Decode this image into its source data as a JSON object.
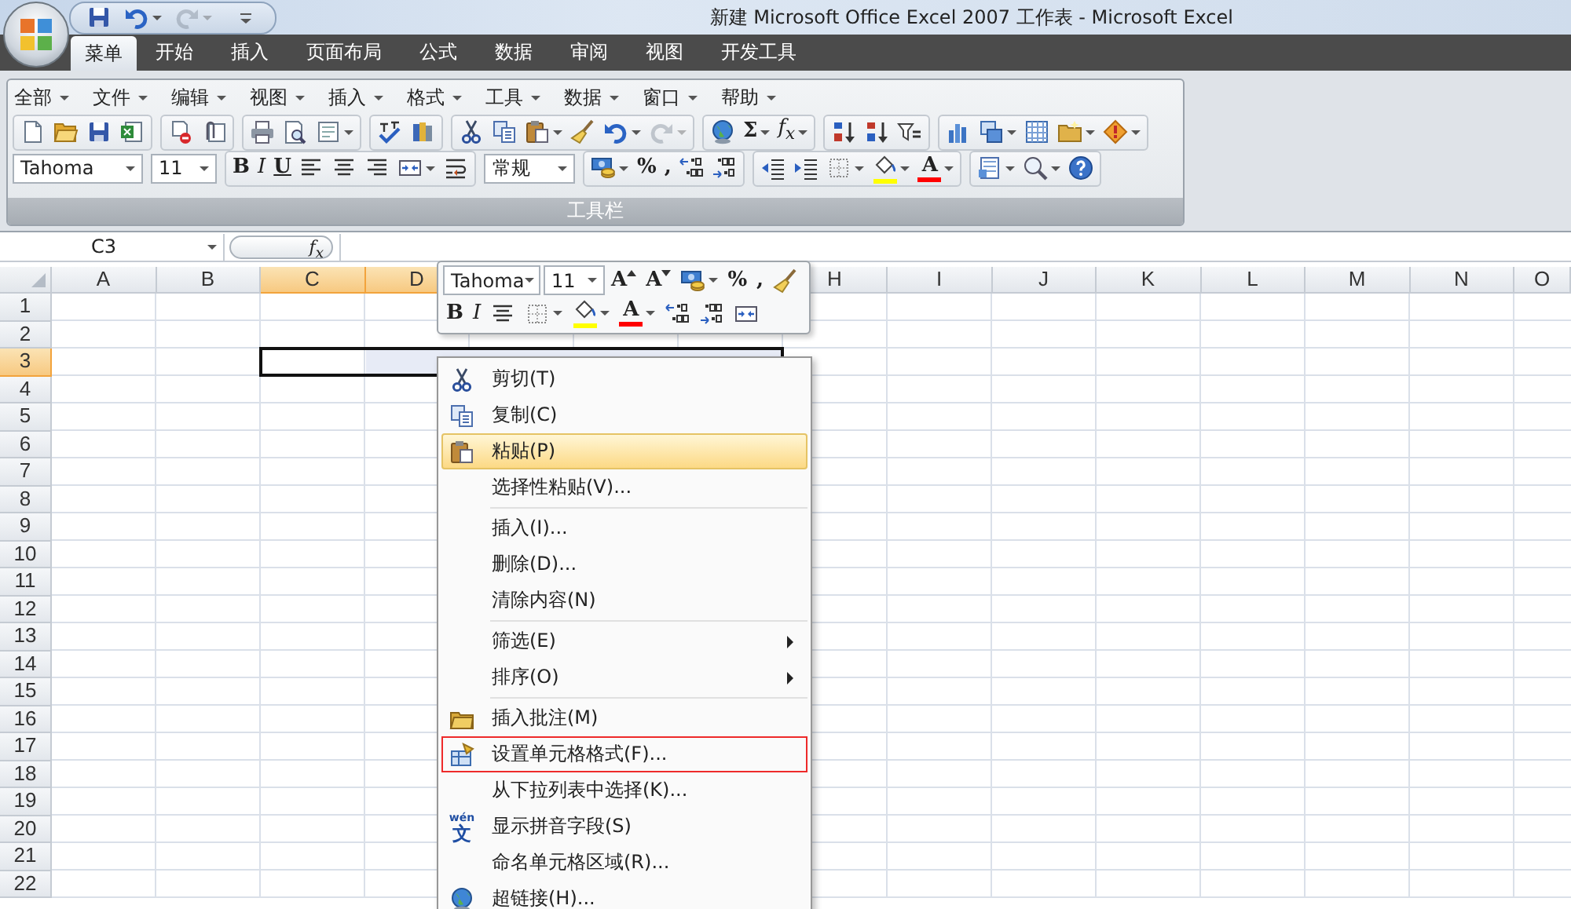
{
  "title_bar": {
    "title": "新建 Microsoft Office Excel 2007 工作表 - Microsoft Excel"
  },
  "quick_access": [
    {
      "kind": "icon"
    },
    {
      "kind": "icon",
      "dropdown": true
    },
    {
      "kind": "icon",
      "dropdown": true,
      "disabled": true
    },
    {
      "kind": "icon"
    }
  ],
  "ribbon_tabs": [
    {
      "label": "菜单",
      "selected": true
    },
    {
      "label": "开始",
      "selected": false
    },
    {
      "label": "插入",
      "selected": false
    },
    {
      "label": "页面布局",
      "selected": false
    },
    {
      "label": "公式",
      "selected": false
    },
    {
      "label": "数据",
      "selected": false
    },
    {
      "label": "审阅",
      "selected": false
    },
    {
      "label": "视图",
      "selected": false
    },
    {
      "label": "开发工具",
      "selected": false
    }
  ],
  "toolbar": {
    "menus": [
      {
        "label": "全部"
      },
      {
        "label": "文件"
      },
      {
        "label": "编辑"
      },
      {
        "label": "视图"
      },
      {
        "label": "插入"
      },
      {
        "label": "格式"
      },
      {
        "label": "工具"
      },
      {
        "label": "数据"
      },
      {
        "label": "窗口"
      },
      {
        "label": "帮助"
      }
    ],
    "standard_groups": [
      [
        {
          "kind": "icon"
        },
        {
          "kind": "icon"
        },
        {
          "kind": "icon"
        },
        {
          "kind": "icon"
        }
      ],
      [
        {
          "kind": "icon"
        },
        {
          "kind": "icon"
        }
      ],
      [
        {
          "kind": "icon"
        },
        {
          "kind": "icon"
        },
        {
          "kind": "icon",
          "dropdown": true
        }
      ],
      [
        {
          "kind": "icon"
        },
        {
          "kind": "icon"
        }
      ],
      [
        {
          "kind": "icon"
        },
        {
          "kind": "icon"
        },
        {
          "kind": "icon",
          "dropdown": true
        },
        {
          "kind": "icon"
        },
        {
          "kind": "icon",
          "dropdown": true
        },
        {
          "kind": "icon",
          "dropdown": true,
          "disabled": true
        }
      ],
      [
        {
          "kind": "icon"
        },
        {
          "kind": "glyph",
          "text": "Σ",
          "dropdown": true
        },
        {
          "kind": "italic",
          "text": "f$_{x}$",
          "dropdown": true
        }
      ],
      [
        {
          "kind": "icon"
        },
        {
          "kind": "icon"
        },
        {
          "kind": "icon"
        }
      ],
      [
        {
          "kind": "icon"
        },
        {
          "kind": "icon",
          "dropdown": true
        },
        {
          "kind": "icon"
        },
        {
          "kind": "icon",
          "dropdown": true
        },
        {
          "kind": "icon",
          "dropdown": true
        }
      ]
    ],
    "formatting_groups": [
      [
        {
          "kind": "fontbox",
          "value": "Tahoma"
        }
      ],
      [
        {
          "kind": "sizebox",
          "value": "11"
        }
      ],
      [
        {
          "kind": "glyph",
          "text": "B"
        },
        {
          "kind": "italic",
          "text": "I"
        },
        {
          "kind": "underline",
          "text": "U"
        },
        {
          "kind": "icon"
        },
        {
          "kind": "icon"
        },
        {
          "kind": "icon"
        },
        {
          "kind": "icon",
          "dropdown": true
        },
        {
          "kind": "icon"
        }
      ],
      [
        {
          "kind": "formatbox",
          "value": "常规"
        }
      ],
      [
        {
          "kind": "icon",
          "dropdown": true
        },
        {
          "kind": "glyph",
          "text": "%"
        },
        {
          "kind": "glyph",
          "text": ","
        },
        {
          "kind": "icon"
        },
        {
          "kind": "icon"
        }
      ],
      [
        {
          "kind": "icon"
        },
        {
          "kind": "icon"
        },
        {
          "kind": "icon",
          "dropdown": true
        },
        {
          "kind": "icon",
          "dropdown": true,
          "color": "#ffff00"
        },
        {
          "kind": "glyph",
          "text": "A",
          "dropdown": true,
          "color": "#ff0000"
        }
      ],
      [
        {
          "kind": "icon",
          "dropdown": true
        },
        {
          "kind": "icon",
          "dropdown": true
        },
        {
          "kind": "icon"
        }
      ]
    ],
    "group_label": "工具栏"
  },
  "formula_bar": {
    "name_box": "C3",
    "function_button": "f$_{x}$"
  },
  "sheet": {
    "columns": [
      {
        "label": "A",
        "selected": false
      },
      {
        "label": "B",
        "selected": false
      },
      {
        "label": "C",
        "selected": true
      },
      {
        "label": "D",
        "selected": true
      },
      {
        "selected": true
      },
      {
        "selected": true
      },
      {
        "selected": true
      },
      {
        "label": "H",
        "selected": false
      },
      {
        "label": "I",
        "selected": false
      },
      {
        "label": "J",
        "selected": false
      },
      {
        "label": "K",
        "selected": false
      },
      {
        "label": "L",
        "selected": false
      },
      {
        "label": "M",
        "selected": false
      },
      {
        "label": "N",
        "selected": false
      },
      {
        "label": "O",
        "selected": false
      }
    ],
    "rows": [
      {
        "label": "1",
        "selected": false
      },
      {
        "label": "2",
        "selected": false
      },
      {
        "label": "3",
        "selected": true
      },
      {
        "label": "4",
        "selected": false
      },
      {
        "label": "5",
        "selected": false
      },
      {
        "label": "6",
        "selected": false
      },
      {
        "label": "7",
        "selected": false
      },
      {
        "label": "8",
        "selected": false
      },
      {
        "label": "9",
        "selected": false
      },
      {
        "label": "10",
        "selected": false
      },
      {
        "label": "11",
        "selected": false
      },
      {
        "label": "12",
        "selected": false
      },
      {
        "label": "13",
        "selected": false
      },
      {
        "label": "14",
        "selected": false
      },
      {
        "label": "15",
        "selected": false
      },
      {
        "label": "16",
        "selected": false
      },
      {
        "label": "17",
        "selected": false
      },
      {
        "label": "18",
        "selected": false
      },
      {
        "label": "19",
        "selected": false
      },
      {
        "label": "20",
        "selected": false
      },
      {
        "label": "21",
        "selected": false
      },
      {
        "label": "22",
        "selected": false
      }
    ]
  },
  "mini_toolbar": {
    "upper_buttons": [
      {
        "kind": "fontbox",
        "value": "Tahoma"
      },
      {
        "kind": "sizebox",
        "value": "11"
      },
      {
        "kind": "grow",
        "text": "A"
      },
      {
        "kind": "shrink",
        "text": "A"
      },
      {
        "kind": "icon",
        "dropdown": true
      },
      {
        "kind": "glyph",
        "text": "%"
      },
      {
        "kind": "glyph",
        "text": ","
      },
      {
        "kind": "icon"
      }
    ],
    "lower_buttons": [
      {
        "kind": "glyph",
        "text": "B"
      },
      {
        "kind": "italic",
        "text": "I"
      },
      {
        "kind": "icon"
      },
      {
        "kind": "icon",
        "dropdown": true
      },
      {
        "kind": "icon",
        "dropdown": true,
        "color": "#ffff00"
      },
      {
        "kind": "glyph",
        "text": "A",
        "dropdown": true,
        "color": "#ff0000"
      },
      {
        "kind": "icon"
      },
      {
        "kind": "icon"
      },
      {
        "kind": "icon"
      }
    ]
  },
  "context_menu": {
    "items": [
      {
        "kind": "item",
        "label": "剪切(T)",
        "icon": true,
        "hovered": false
      },
      {
        "kind": "item",
        "label": "复制(C)",
        "icon": true,
        "hovered": false
      },
      {
        "kind": "item",
        "label": "粘贴(P)",
        "icon": true,
        "hovered": true
      },
      {
        "kind": "item",
        "label": "选择性粘贴(V)...",
        "hovered": false
      },
      {
        "kind": "separator"
      },
      {
        "kind": "item",
        "label": "插入(I)...",
        "hovered": false
      },
      {
        "kind": "item",
        "label": "删除(D)...",
        "hovered": false
      },
      {
        "kind": "item",
        "label": "清除内容(N)",
        "hovered": false
      },
      {
        "kind": "separator"
      },
      {
        "kind": "item",
        "label": "筛选(E)",
        "submenu": true,
        "hovered": false
      },
      {
        "kind": "item",
        "label": "排序(O)",
        "submenu": true,
        "hovered": false
      },
      {
        "kind": "separator"
      },
      {
        "kind": "item",
        "label": "插入批注(M)",
        "icon": true,
        "hovered": false
      },
      {
        "kind": "item",
        "label": "设置单元格格式(F)...",
        "icon": true,
        "hovered": false,
        "outlined": true
      },
      {
        "kind": "item",
        "label": "从下拉列表中选择(K)...",
        "hovered": false
      },
      {
        "kind": "item",
        "label": "显示拼音字段(S)",
        "icon_ruby": "wén",
        "icon_text": "文",
        "hovered": false
      },
      {
        "kind": "item",
        "label": "命名单元格区域(R)...",
        "hovered": false
      },
      {
        "kind": "item",
        "label": "超链接(H)...",
        "icon": true,
        "hovered": false
      }
    ]
  }
}
